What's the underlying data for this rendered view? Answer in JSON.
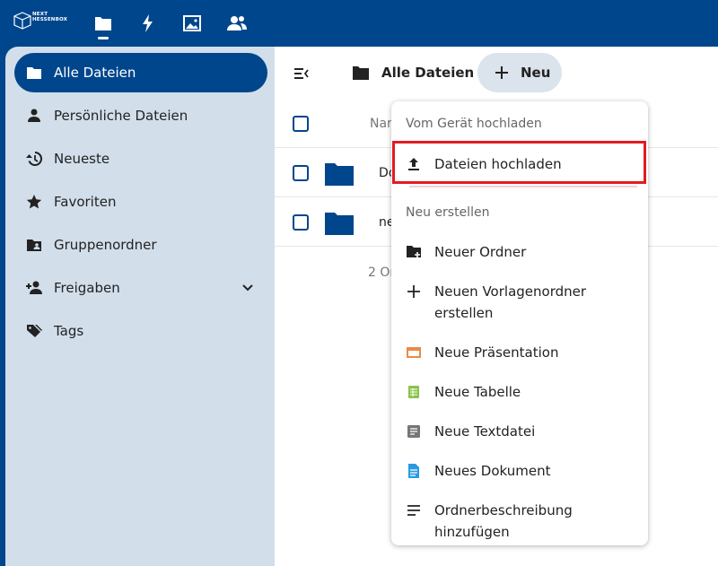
{
  "header": {
    "logo_line1": "NEXT",
    "logo_line2": "HESSENBOX",
    "apps": [
      {
        "name": "files",
        "icon": "folder-icon",
        "active": true
      },
      {
        "name": "activity",
        "icon": "lightning-icon",
        "active": false
      },
      {
        "name": "photos",
        "icon": "image-icon",
        "active": false
      },
      {
        "name": "contacts",
        "icon": "people-icon",
        "active": false
      }
    ]
  },
  "sidebar": {
    "items": [
      {
        "label": "Alle Dateien",
        "icon": "folder-icon",
        "active": true
      },
      {
        "label": "Persönliche Dateien",
        "icon": "person-icon",
        "active": false
      },
      {
        "label": "Neueste",
        "icon": "history-icon",
        "active": false
      },
      {
        "label": "Favoriten",
        "icon": "star-icon",
        "active": false
      },
      {
        "label": "Gruppenordner",
        "icon": "group-folder-icon",
        "active": false
      },
      {
        "label": "Freigaben",
        "icon": "share-person-icon",
        "active": false,
        "expandable": true
      },
      {
        "label": "Tags",
        "icon": "tag-icon",
        "active": false
      }
    ]
  },
  "main": {
    "breadcrumb": "Alle Dateien",
    "new_button": "Neu",
    "column_name": "Nar",
    "rows": [
      {
        "name": "Do"
      },
      {
        "name": "ne"
      }
    ],
    "summary": "2 Or"
  },
  "menu": {
    "upload_caption": "Vom Gerät hochladen",
    "upload_files": "Dateien hochladen",
    "create_caption": "Neu erstellen",
    "new_folder": "Neuer Ordner",
    "new_template_folder_1": "Neuen Vorlagenordner",
    "new_template_folder_2": "erstellen",
    "new_presentation": "Neue Präsentation",
    "new_spreadsheet": "Neue Tabelle",
    "new_textfile": "Neue Textdatei",
    "new_document": "Neues Dokument",
    "folder_description_1": "Ordnerbeschreibung",
    "folder_description_2": "hinzufügen"
  },
  "colors": {
    "brand": "#00468c",
    "sidebar_bg": "#d2deea",
    "highlight": "#e21b23",
    "presentation": "#e98a46",
    "spreadsheet": "#8bc34a",
    "document": "#2a9ae0"
  }
}
